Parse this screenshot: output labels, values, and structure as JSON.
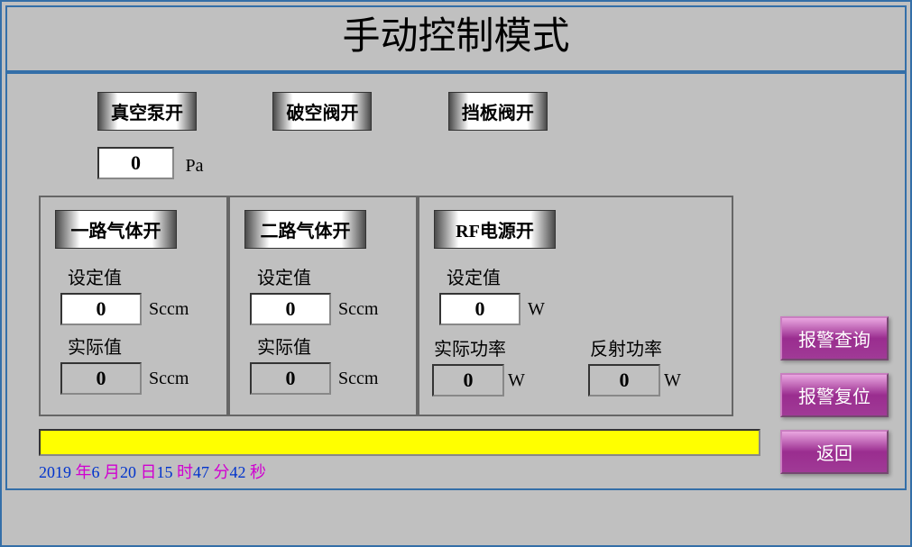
{
  "title": "手动控制模式",
  "top_buttons": {
    "vacuum_pump": "真空泵开",
    "break_valve": "破空阀开",
    "baffle_valve": "挡板阀开"
  },
  "vacuum": {
    "value": "0",
    "unit": "Pa"
  },
  "gas1": {
    "button": "一路气体开",
    "set_label": "设定值",
    "set_value": "0",
    "set_unit": "Sccm",
    "act_label": "实际值",
    "act_value": "0",
    "act_unit": "Sccm"
  },
  "gas2": {
    "button": "二路气体开",
    "set_label": "设定值",
    "set_value": "0",
    "set_unit": "Sccm",
    "act_label": "实际值",
    "act_value": "0",
    "act_unit": "Sccm"
  },
  "rf": {
    "button": "RF电源开",
    "set_label": "设定值",
    "set_value": "0",
    "set_unit": "W",
    "actual_label": "实际功率",
    "actual_value": "0",
    "actual_unit": "W",
    "reflect_label": "反射功率",
    "reflect_value": "0",
    "reflect_unit": "W"
  },
  "status_text": "",
  "clock": {
    "year_val": "2019",
    "year_lbl": "年",
    "month_val": "6",
    "month_lbl": "月",
    "day_val": "20",
    "day_lbl": "日",
    "hour_val": "15",
    "hour_lbl": "时",
    "min_val": "47",
    "min_lbl": "分",
    "sec_val": "42",
    "sec_lbl": "秒"
  },
  "right": {
    "alarm_query": "报警查询",
    "alarm_reset": "报警复位",
    "back": "返回"
  }
}
